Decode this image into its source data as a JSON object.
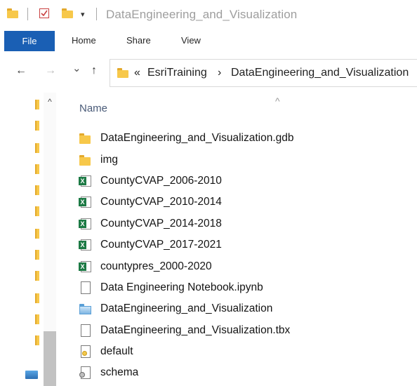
{
  "window": {
    "title": "DataEngineering_and_Visualization",
    "quick_access_dropdown": "▾"
  },
  "ribbon": {
    "tabs": [
      {
        "label": "File",
        "active": true
      },
      {
        "label": "Home",
        "active": false
      },
      {
        "label": "Share",
        "active": false
      },
      {
        "label": "View",
        "active": false
      }
    ]
  },
  "nav": {
    "back_icon": "←",
    "forward_icon": "→",
    "recent_icon": "⌄",
    "up_icon": "↑"
  },
  "address": {
    "overflow": "«",
    "separator": "›",
    "crumbs": [
      "EsriTraining",
      "DataEngineering_and_Visualization"
    ]
  },
  "file_list": {
    "sort_indicator": "^",
    "column_header": "Name",
    "items": [
      {
        "name": "DataEngineering_and_Visualization.gdb",
        "icon": "folder-icon"
      },
      {
        "name": "img",
        "icon": "folder-icon"
      },
      {
        "name": "CountyCVAP_2006-2010",
        "icon": "excel-file-icon"
      },
      {
        "name": "CountyCVAP_2010-2014",
        "icon": "excel-file-icon"
      },
      {
        "name": "CountyCVAP_2014-2018",
        "icon": "excel-file-icon"
      },
      {
        "name": "CountyCVAP_2017-2021",
        "icon": "excel-file-icon"
      },
      {
        "name": "countypres_2000-2020",
        "icon": "excel-file-icon"
      },
      {
        "name": "Data Engineering Notebook.ipynb",
        "icon": "document-icon"
      },
      {
        "name": "DataEngineering_and_Visualization",
        "icon": "arcgis-project-icon"
      },
      {
        "name": "DataEngineering_and_Visualization.tbx",
        "icon": "document-icon"
      },
      {
        "name": "default",
        "icon": "settings-file-icon"
      },
      {
        "name": "schema",
        "icon": "script-file-icon"
      }
    ]
  },
  "colors": {
    "file_tab_bg": "#1a5fb4",
    "folder_yellow": "#f7c84a",
    "excel_green": "#1d7a45",
    "header_text": "#4a5b78"
  }
}
